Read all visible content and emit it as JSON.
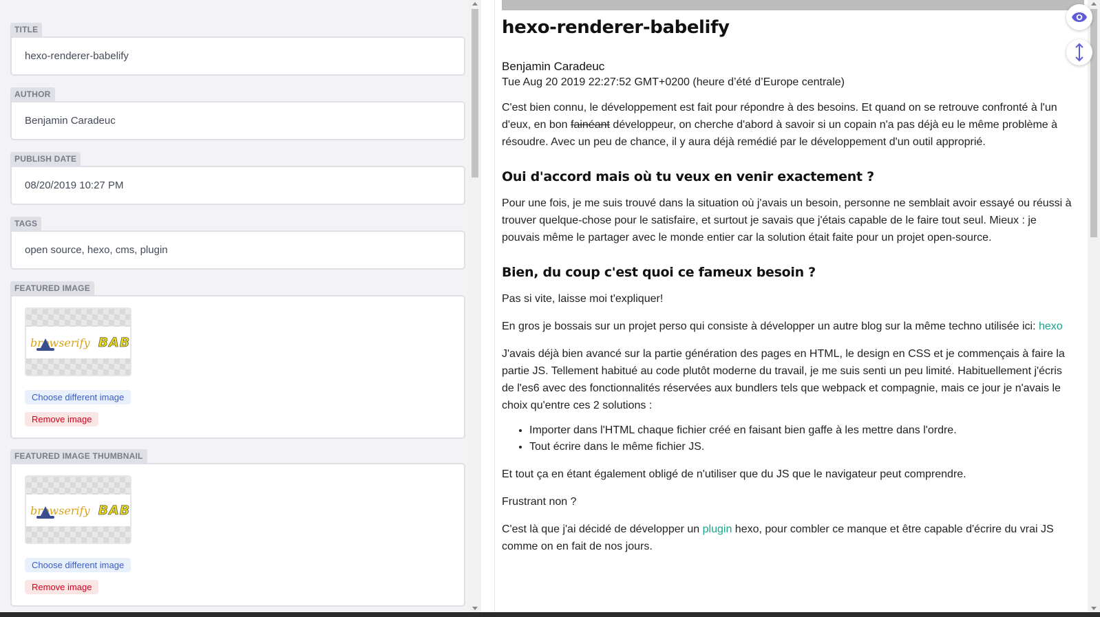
{
  "editor": {
    "title": {
      "label": "Title",
      "value": "hexo-renderer-babelify"
    },
    "author": {
      "label": "Author",
      "value": "Benjamin Caradeuc"
    },
    "publish_date": {
      "label": "Publish Date",
      "value": "08/20/2019 10:27 PM"
    },
    "tags": {
      "label": "Tags",
      "value": "open source, hexo, cms, plugin"
    },
    "featured_image": {
      "label": "Featured Image",
      "logo_left": "browserify",
      "logo_right": "BABEL",
      "choose_label": "Choose different image",
      "remove_label": "Remove image"
    },
    "featured_image_thumbnail": {
      "label": "Featured Image Thumbnail",
      "logo_left": "browserify",
      "logo_right": "BABEL",
      "choose_label": "Choose different image",
      "remove_label": "Remove image"
    }
  },
  "preview": {
    "title": "hexo-renderer-babelify",
    "author": "Benjamin Caradeuc",
    "date": "Tue Aug 20 2019 22:27:52 GMT+0200 (heure d’été d’Europe centrale)",
    "p1_before": "C'est bien connu, le développement est fait pour répondre à des besoins. Et quand on se retrouve confronté à l'un d'eux, en bon ",
    "p1_strike": "fainéant",
    "p1_after": " développeur, on cherche d'abord à savoir si un copain n'a pas déjà eu le même problème à résoudre. Avec un peu de chance, il y aura déjà remédié par le développement d'un outil approprié.",
    "h2_1": "Oui d'accord mais où tu veux en venir exactement ?",
    "p2": "Pour une fois, je me suis trouvé dans la situation où j'avais un besoin, personne ne semblait avoir essayé ou réussi à trouver quelque-chose pour le satisfaire, et surtout je savais que j'étais capable de le faire tout seul. Mieux : je pouvais même le partager avec le monde entier car la solution était faite pour un projet open-source.",
    "h2_2": "Bien, du coup c'est quoi ce fameux besoin ?",
    "p3": "Pas si vite, laisse moi t'expliquer!",
    "p4_before": "En gros je bossais sur un projet perso qui consiste à développer un autre blog sur la même techno utilisée ici: ",
    "p4_link": "hexo",
    "p5": "J'avais déjà bien avancé sur la partie génération des pages en HTML, le design en CSS et je commençais à faire la partie JS. Tellement habitué au code plutôt moderne du travail, je me suis senti un peu limité. Habituellement j'écris de l'es6 avec des fonctionnalités réservées aux bundlers tels que webpack et compagnie, mais ce jour je n'avais le choix qu'entre ces 2 solutions :",
    "list": [
      "Importer dans l'HTML chaque fichier créé en faisant bien gaffe à les mettre dans l'ordre.",
      "Tout écrire dans le même fichier JS."
    ],
    "p6": "Et tout ça en étant également obligé de n'utiliser que du JS que le navigateur peut comprendre.",
    "p7": "Frustrant non ?",
    "p8_before": "C'est là que j'ai décidé de développer un ",
    "p8_link": "plugin",
    "p8_after": " hexo, pour combler ce manque et être capable d'écrire du vrai JS comme on en fait de nos jours."
  },
  "controls": {
    "eye_icon": "eye-icon",
    "scroll_sync_icon": "vertical-arrows-icon"
  },
  "colors": {
    "accent": "#5e5bd9",
    "link": "#1aa58a",
    "remove": "#d0021b",
    "choose": "#3a5cc5"
  }
}
